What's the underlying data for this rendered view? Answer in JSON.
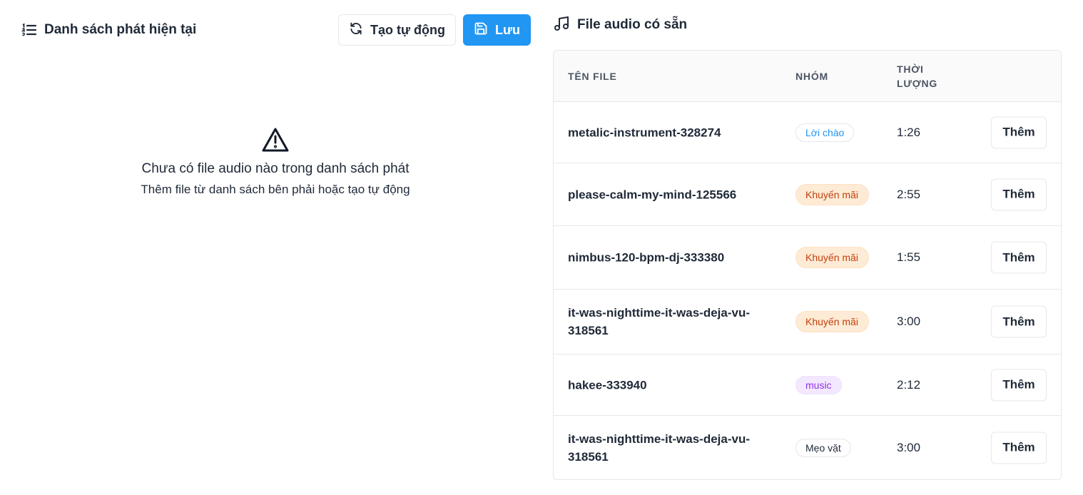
{
  "left": {
    "title": "Danh sách phát hiện tại",
    "title_icon": "list-icon",
    "auto_button": {
      "label": "Tạo tự động",
      "icon": "refresh-icon"
    },
    "save_button": {
      "label": "Lưu",
      "icon": "floppy-disk-icon"
    },
    "empty": {
      "icon": "warning-triangle-icon",
      "title": "Chưa có file audio nào trong danh sách phát",
      "subtitle": "Thêm file từ danh sách bên phải hoặc tạo tự động"
    }
  },
  "right": {
    "title": "File audio có sẵn",
    "title_icon": "music-note-icon",
    "columns": {
      "name": "TÊN FILE",
      "group": "NHÓM",
      "duration": "THỜI LƯỢNG"
    },
    "rows": [
      {
        "name": "metalic-instrument-328274",
        "group": "Lời chào",
        "duration": "1:26",
        "action": "Thêm"
      },
      {
        "name": "please-calm-my-mind-125566",
        "group": "Khuyến mãi",
        "duration": "2:55",
        "action": "Thêm"
      },
      {
        "name": "nimbus-120-bpm-dj-333380",
        "group": "Khuyến mãi",
        "duration": "1:55",
        "action": "Thêm"
      },
      {
        "name": "it-was-nighttime-it-was-deja-vu-318561",
        "group": "Khuyến mãi",
        "duration": "3:00",
        "action": "Thêm"
      },
      {
        "name": "hakee-333940",
        "group": "music",
        "duration": "2:12",
        "action": "Thêm"
      },
      {
        "name": "it-was-nighttime-it-was-deja-vu-318561",
        "group": "Mẹo vặt",
        "duration": "3:00",
        "action": "Thêm"
      }
    ]
  },
  "colors": {
    "primary": "#2196f3",
    "tag_orange_bg": "#feebd6",
    "tag_orange_text": "#c2410c",
    "tag_purple_bg": "#f3e8ff",
    "tag_purple_text": "#9333ea"
  }
}
